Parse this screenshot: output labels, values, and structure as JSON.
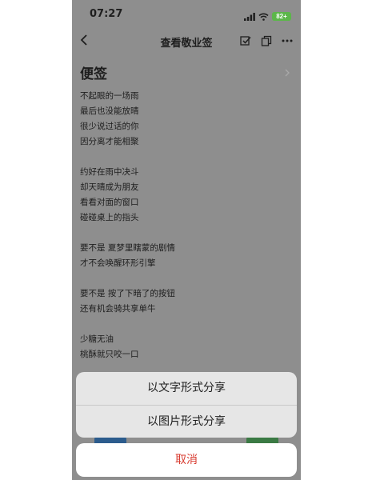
{
  "status_bar": {
    "time": "07:27",
    "battery": "82+",
    "signal_icon": "signal-icon",
    "wifi_icon": "wifi-icon"
  },
  "nav": {
    "title": "查看敬业签",
    "back_icon": "chevron-left-icon",
    "actions": [
      "checkbox-icon",
      "copy-icon",
      "more-icon"
    ]
  },
  "note": {
    "heading": "便签",
    "stanzas": [
      [
        "不起眼的一场雨",
        "最后也没能放晴",
        "很少说过话的你",
        "因分离才能相聚"
      ],
      [
        "约好在雨中决斗",
        "却天晴成为朋友",
        "看看对面的窗口",
        "碰碰桌上的指头"
      ],
      [
        "要不是 夏梦里瞎蒙的剧情",
        "才不会唤醒环形引擎"
      ],
      [
        "要不是 按了下暗了的按钮",
        "还有机会骑共享单牛"
      ],
      [
        "少糖无油",
        "桃酥就只咬一口"
      ]
    ]
  },
  "share_sheet": {
    "option_text": "以文字形式分享",
    "option_image": "以图片形式分享",
    "cancel": "取消"
  },
  "colors": {
    "overlay": "#8e8e8e",
    "sheet": "#e6e6e6",
    "cancel_text": "#d83b30",
    "battery": "#5cb64a"
  }
}
